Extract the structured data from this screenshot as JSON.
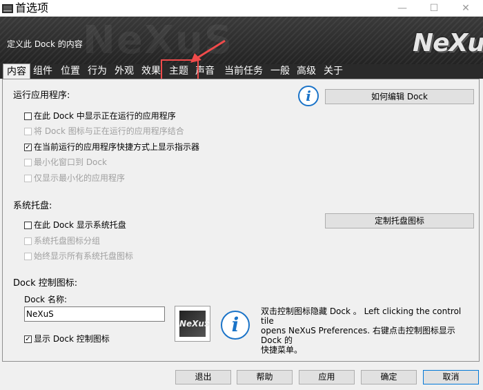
{
  "window": {
    "title": "首选项",
    "minimize_glyph": "—",
    "maximize_glyph": "☐",
    "close_glyph": "✕"
  },
  "banner": {
    "subtitle": "定义此 Dock 的内容",
    "logo_text": "NeXuS",
    "watermark_text": "NeXuS"
  },
  "tabs": [
    {
      "label": "内容"
    },
    {
      "label": "组件"
    },
    {
      "label": "位置"
    },
    {
      "label": "行为"
    },
    {
      "label": "外观"
    },
    {
      "label": "效果"
    },
    {
      "label": "主题"
    },
    {
      "label": "声音"
    },
    {
      "label": "当前任务"
    },
    {
      "label": "一般"
    },
    {
      "label": "高级"
    },
    {
      "label": "关于"
    }
  ],
  "running_apps": {
    "heading": "运行应用程序:",
    "help_button": "如何编辑 Dock",
    "options": [
      {
        "label": "在此 Dock 中显示正在运行的应用程序",
        "checked": false,
        "enabled": true
      },
      {
        "label": "将 Dock 图标与正在运行的应用程序结合",
        "checked": false,
        "enabled": false
      },
      {
        "label": "在当前运行的应用程序快捷方式上显示指示器",
        "checked": true,
        "enabled": true
      },
      {
        "label": "最小化窗口到 Dock",
        "checked": false,
        "enabled": false
      },
      {
        "label": "仅显示最小化的应用程序",
        "checked": false,
        "enabled": false
      }
    ]
  },
  "system_tray": {
    "heading": "系统托盘:",
    "customize_button": "定制托盘图标",
    "options": [
      {
        "label": "在此 Dock 显示系统托盘",
        "checked": false,
        "enabled": true
      },
      {
        "label": "系统托盘图标分组",
        "checked": false,
        "enabled": false
      },
      {
        "label": "始终显示所有系统托盘图标",
        "checked": false,
        "enabled": false
      }
    ]
  },
  "dock_control": {
    "heading": "Dock 控制图标:",
    "name_label": "Dock 名称:",
    "name_value": "NeXuS",
    "thumbnail_text": "NeXuS",
    "show_icon_label": "显示 Dock 控制图标",
    "show_icon_checked": true,
    "description_line1": "双击控制图标隐藏 Dock 。 Left clicking the control tile",
    "description_line2": "opens NeXuS Preferences. 右键点击控制图标显示 Dock 的",
    "description_line3": "快捷菜单。"
  },
  "info_glyph": "i",
  "footer": {
    "exit": "退出",
    "help": "帮助",
    "apply": "应用",
    "ok": "确定",
    "cancel": "取消"
  },
  "colors": {
    "accent_highlight": "#f04b4b",
    "info_blue": "#1a73c8"
  }
}
